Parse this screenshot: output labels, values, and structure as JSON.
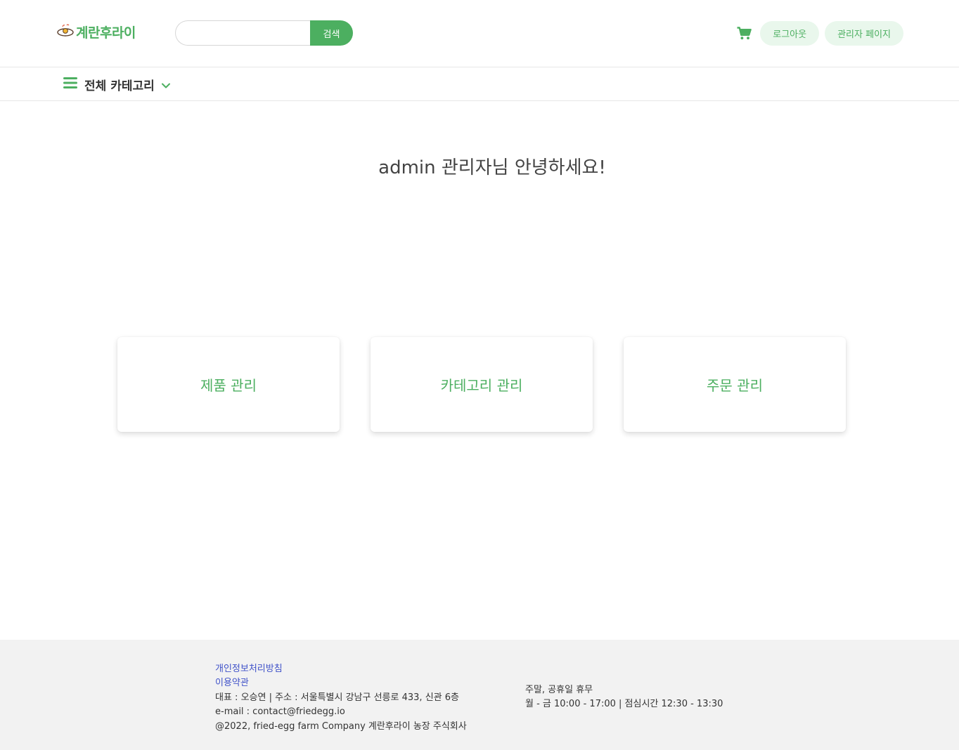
{
  "header": {
    "logo_text": "계란후라이",
    "search": {
      "placeholder": "",
      "value": "",
      "button_label": "검색"
    },
    "cart_icon": "shopping-cart-icon",
    "logout_label": "로그아웃",
    "admin_page_label": "관리자 페이지"
  },
  "category_bar": {
    "menu_icon": "hamburger-icon",
    "label": "전체 카테고리",
    "chevron_icon": "chevron-down-icon"
  },
  "main": {
    "greeting": "admin 관리자님 안녕하세요!",
    "cards": [
      {
        "label": "제품 관리"
      },
      {
        "label": "카테고리 관리"
      },
      {
        "label": "주문 관리"
      }
    ]
  },
  "footer": {
    "privacy_link": "개인정보처리방침",
    "terms_link": "이용약관",
    "company_info": "대표 : 오승연 | 주소 : 서울특별시 강남구 선릉로 433, 신관 6층",
    "email": "e-mail : contact@friedegg.io",
    "copyright": "@2022, fried-egg farm Company 계란후라이 농장 주식회사",
    "holiday_notice": "주말, 공휴일 휴무",
    "hours": "월 - 금 10:00 - 17:00 | 점심시간 12:30 - 13:30"
  },
  "colors": {
    "accent": "#4caf60",
    "accent_light": "#e9f7ec",
    "link": "#4052c9",
    "footer_bg": "#f2f2f2"
  }
}
